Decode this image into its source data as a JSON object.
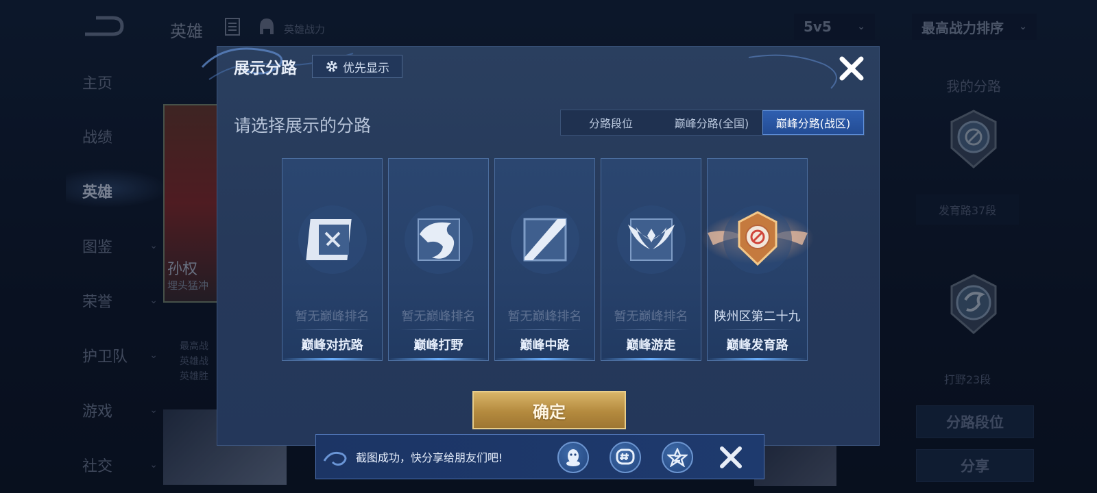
{
  "header": {
    "title": "英雄",
    "power_label": "英雄战力",
    "mode_dropdown": "5v5",
    "sort_dropdown": "最高战力排序"
  },
  "nav": {
    "items": [
      {
        "label": "主页",
        "has_chevron": false
      },
      {
        "label": "战绩",
        "has_chevron": false
      },
      {
        "label": "英雄",
        "has_chevron": false,
        "active": true
      },
      {
        "label": "图鉴",
        "has_chevron": true
      },
      {
        "label": "荣誉",
        "has_chevron": true
      },
      {
        "label": "护卫队",
        "has_chevron": true
      },
      {
        "label": "游戏",
        "has_chevron": true
      },
      {
        "label": "社交",
        "has_chevron": true
      }
    ]
  },
  "hero": {
    "name": "孙权",
    "subtitle": "埋头猛冲",
    "stats": [
      "最高战",
      "英雄战",
      "英雄胜"
    ]
  },
  "right_panel": {
    "title": "我的分路",
    "lane1_label": "发育路37段",
    "lane2_label": "打野23段",
    "lane_rank_button": "分路段位",
    "share_button": "分享"
  },
  "modal": {
    "title": "展示分路",
    "priority_button": "优先显示",
    "subtitle": "请选择展示的分路",
    "tabs": [
      {
        "label": "分路段位",
        "active": false
      },
      {
        "label": "巅峰分路(全国)",
        "active": false
      },
      {
        "label": "巅峰分路(战区)",
        "active": true
      }
    ],
    "cards": [
      {
        "rank": "暂无巅峰排名",
        "name": "巅峰对抗路",
        "icon": "clash-lane-icon",
        "lit": false
      },
      {
        "rank": "暂无巅峰排名",
        "name": "巅峰打野",
        "icon": "jungle-dragon-icon",
        "lit": false
      },
      {
        "rank": "暂无巅峰排名",
        "name": "巅峰中路",
        "icon": "mid-lane-icon",
        "lit": false
      },
      {
        "rank": "暂无巅峰排名",
        "name": "巅峰游走",
        "icon": "roam-wings-icon",
        "lit": false
      },
      {
        "rank": "陕州区第二十九",
        "name": "巅峰发育路",
        "icon": "farm-lane-gold-badge-icon",
        "lit": true
      }
    ],
    "confirm_button": "确定"
  },
  "toast": {
    "text": "截图成功，快分享给朋友们吧!",
    "share_targets": [
      "qq-icon",
      "wechat-moments-icon",
      "qzone-icon"
    ]
  },
  "colors": {
    "modal_bg": "#26395a",
    "active_tab": "#2f5fb0",
    "confirm_gold": "#c9a255"
  }
}
